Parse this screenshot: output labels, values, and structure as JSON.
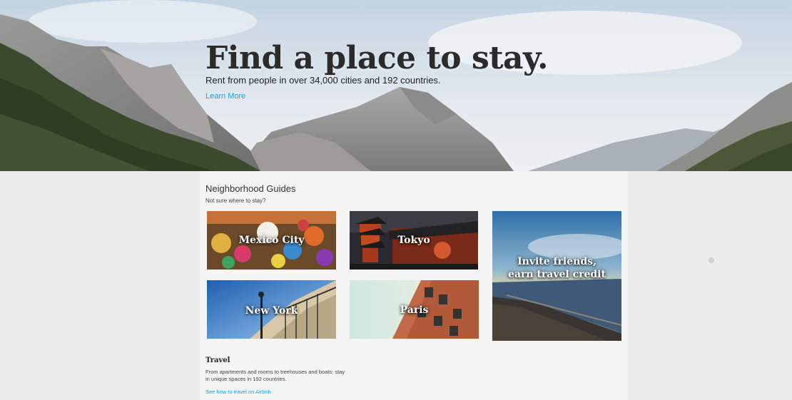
{
  "hero": {
    "title": "Find a place to stay.",
    "subtitle": "Rent from people in over 34,000 cities and 192 countries.",
    "link": "Learn More"
  },
  "neighborhoods": {
    "title": "Neighborhood Guides",
    "subtitle": "Not sure where to stay?",
    "tiles": [
      {
        "label": "Mexico City"
      },
      {
        "label": "Tokyo"
      },
      {
        "label": "New York"
      },
      {
        "label": "Paris"
      }
    ],
    "invite": {
      "line1": "Invite friends,",
      "line2": "earn travel credit"
    }
  },
  "travel": {
    "title": "Travel",
    "text": "From apartments and rooms to treehouses and boats: stay in unique spaces in 192 countries.",
    "link": "See how to travel on Airbnb"
  },
  "colors": {
    "link": "#1a9fe0",
    "panel": "#f4f4f4",
    "page": "#ececec"
  }
}
